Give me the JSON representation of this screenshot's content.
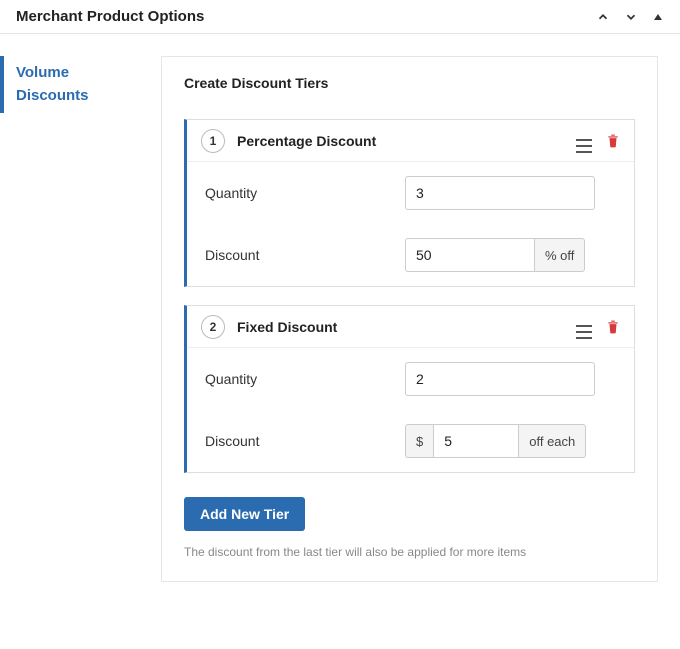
{
  "header": {
    "title": "Merchant Product Options"
  },
  "sidebar": {
    "tabs": [
      {
        "label": "Volume Discounts"
      }
    ]
  },
  "panel": {
    "title": "Create Discount Tiers",
    "quantity_label": "Quantity",
    "discount_label": "Discount",
    "percent_suffix": "% off",
    "currency_prefix": "$",
    "off_each_suffix": "off each",
    "tiers": [
      {
        "index": "1",
        "title": "Percentage Discount",
        "quantity": "3",
        "discount": "50",
        "type": "percent"
      },
      {
        "index": "2",
        "title": "Fixed Discount",
        "quantity": "2",
        "discount": "5",
        "type": "fixed"
      }
    ],
    "add_button": "Add New Tier",
    "note": "The discount from the last tier will also be applied for more items"
  }
}
